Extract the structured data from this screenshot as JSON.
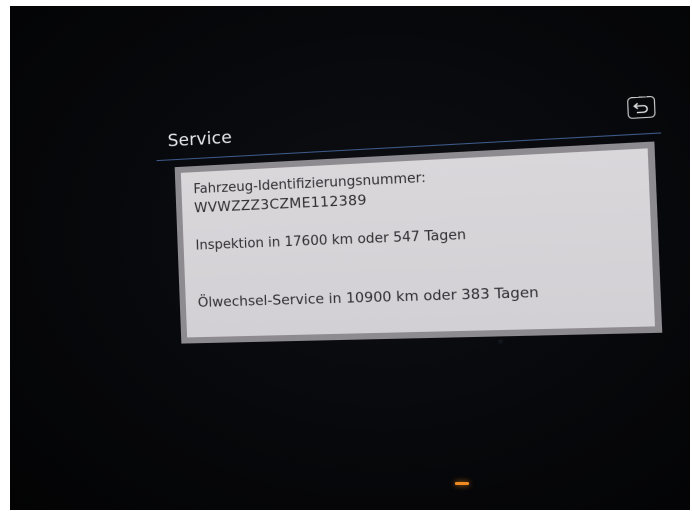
{
  "header": {
    "title": "Service"
  },
  "info": {
    "vin_label": "Fahrzeug-Identifizierungsnummer:",
    "vin_value": "WVWZZZ3CZME112389",
    "inspection": "Inspektion in 17600 km oder 547 Tagen",
    "oil_service": "Ölwechsel-Service in 10900 km oder 383 Tagen"
  },
  "icons": {
    "back": "back-arrow-icon"
  },
  "colors": {
    "background": "#07080b",
    "title_text": "#e8e8ea",
    "divider": "#3d5a8a",
    "card_bg": "#d5d3d7",
    "card_border": "#8d8b8f",
    "card_text": "#2e2e32",
    "indicator": "#f08a22"
  }
}
